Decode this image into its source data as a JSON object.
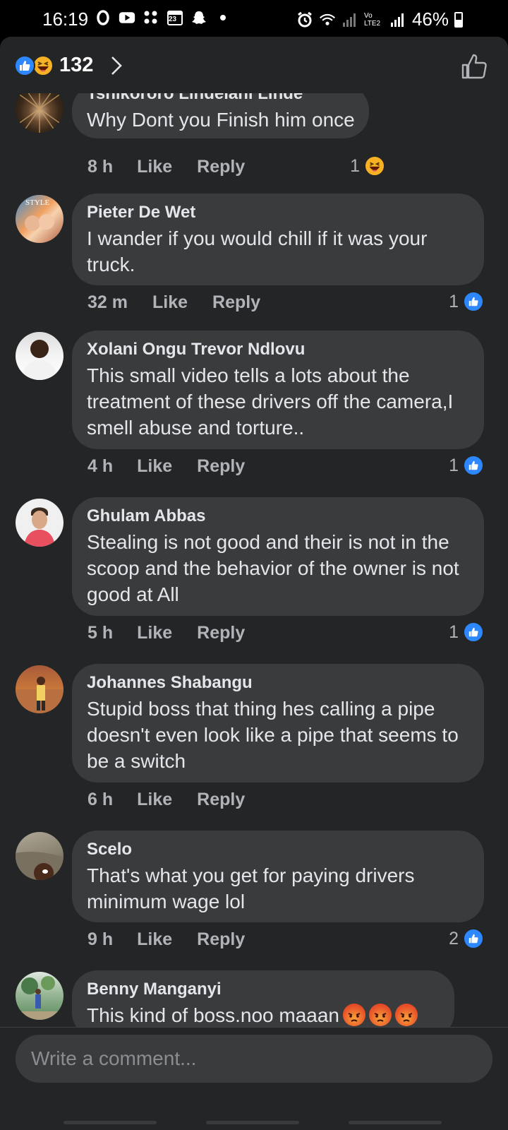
{
  "status_bar": {
    "time": "16:19",
    "battery": "46%",
    "calendar_date": "23",
    "network_label": "Vo LTE2",
    "left_icons": [
      "oval-notification-icon",
      "youtube-icon",
      "grid-icon",
      "calendar-icon",
      "snapchat-icon",
      "dot-icon"
    ],
    "right_icons": [
      "alarm-icon",
      "wifi-icon",
      "signal-icon",
      "volte-icon",
      "signal-icon",
      "battery-icon"
    ]
  },
  "reactions_header": {
    "count": "132",
    "icons": [
      "like-icon",
      "haha-icon"
    ]
  },
  "actions": {
    "like": "Like",
    "reply": "Reply"
  },
  "comments": [
    {
      "author": "Tshikororo Lindelani Linde",
      "text": "Why Dont you Finish him once",
      "time": "8 h",
      "reaction_count": "1",
      "reaction": "haha"
    },
    {
      "author": "Pieter De Wet",
      "text": "I wander if you would chill if it was your truck.",
      "time": "32 m",
      "reaction_count": "1",
      "reaction": "like"
    },
    {
      "author": "Xolani Ongu Trevor Ndlovu",
      "text": "This small video tells a lots about the treatment of these drivers off the camera,I smell abuse and torture..",
      "time": "4 h",
      "reaction_count": "1",
      "reaction": "like"
    },
    {
      "author": "Ghulam Abbas",
      "text": "Stealing is  not good and their is not in the scoop and the behavior of the owner is not good at All",
      "time": "5 h",
      "reaction_count": "1",
      "reaction": "like"
    },
    {
      "author": "Johannes Shabangu",
      "text": "Stupid boss that thing hes calling a pipe doesn't even look like a pipe that seems to be a switch",
      "time": "6 h",
      "reaction_count": "",
      "reaction": ""
    },
    {
      "author": "Scelo",
      "text": "That's what you get for paying drivers minimum wage lol",
      "time": "9 h",
      "reaction_count": "2",
      "reaction": "like"
    },
    {
      "author": "Benny Manganyi",
      "text": "This kind of boss.noo maaan",
      "emojis": [
        "angry-emoji",
        "angry-emoji",
        "angry-emoji"
      ],
      "time": "",
      "reaction_count": "",
      "reaction": ""
    }
  ],
  "composer": {
    "placeholder": "Write a comment..."
  },
  "colors": {
    "background": "#242526",
    "bubble": "#3a3b3c",
    "text_primary": "#e4e6eb",
    "text_secondary": "#b0b3b8",
    "like_blue": "#2d88ff",
    "haha_yellow": "#f7b125"
  }
}
